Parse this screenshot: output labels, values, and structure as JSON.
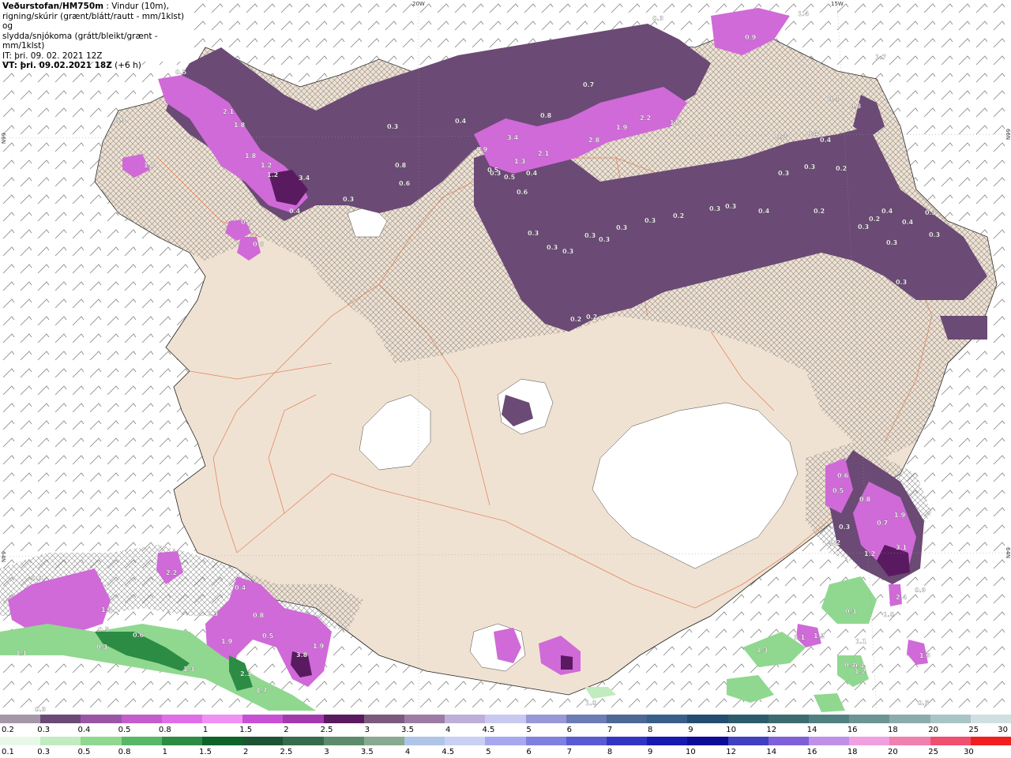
{
  "header": {
    "title": "Veðurstofan/HM750m",
    "desc_1": " : Vindur (10m),",
    "desc_2": "rigning/skúrir (grænt/blátt/rautt - mm/1klst) og",
    "desc_3": "slydda/snjókoma (grátt/bleikt/grænt - mm/1klst)",
    "it_line": "IT: þri. 09. 02. 2021 12Z",
    "vt_label": "VT: þri. 09.02.2021 18Z",
    "vt_offset": " (+6 h)"
  },
  "coords": {
    "lon_top_1": "20W",
    "lon_top_2": "15W",
    "lat_left_1": "66N",
    "lat_right_1": "66N",
    "lat_left_2": "64N",
    "lat_right_2": "64N"
  },
  "colors": {
    "land": "#f0e2d2",
    "sea": "#ffffff",
    "hatch": "#8a8a8a",
    "snow_1": "#6b4a75",
    "snow_2": "#9a55a6",
    "snow_3": "#d06ad8",
    "snow_4": "#e888f0",
    "snow_5": "#f0a8f4",
    "rain_1": "#c8f0c8",
    "rain_2": "#3cb45a",
    "rain_3": "#0e6e2e",
    "roads": "#e07850",
    "glacier": "#ffffff"
  },
  "values_on_map": [
    "0.5",
    "2.1",
    "1.8",
    "1.8",
    "1.2",
    "1.2",
    "3.4",
    "0.4",
    "1.7",
    "0.7",
    "0.6",
    "0.3",
    "0.3",
    "0.3",
    "0.4",
    "0.8",
    "1.4",
    "0.3",
    "0.9",
    "1.7",
    "0.7",
    "0.8",
    "0.6",
    "0.3",
    "0.4",
    "3.4",
    "0.9",
    "0.5",
    "1.3",
    "2.1",
    "2.8",
    "1.9",
    "2.2",
    "1.6",
    "0.2",
    "0.3",
    "0.4",
    "0.8",
    "0.4",
    "0.4",
    "0.5",
    "0.6",
    "0.3",
    "0.3",
    "0.3",
    "0.3",
    "0.3",
    "0.2",
    "0.2",
    "0.3",
    "0.3",
    "0.2",
    "0.3",
    "0.3",
    "0.4",
    "0.3",
    "0.2",
    "0.4",
    "0.3",
    "0.4",
    "0.3",
    "0.3",
    "0.3",
    "0.2",
    "0.2",
    "0.3",
    "1.2",
    "0.3",
    "0.6",
    "0.5",
    "0.8",
    "1.9",
    "0.7",
    "3.1",
    "1.2",
    "0.9",
    "2.4",
    "1.0",
    "0.3",
    "0.4",
    "0.9",
    "1.3",
    "0.5",
    "0.6",
    "0.3",
    "1.1",
    "1.3",
    "1.9",
    "2.3",
    "1.7",
    "3.8",
    "1.9",
    "0.4",
    "0.8",
    "0.5",
    "1.3",
    "2.2",
    "1.2",
    "1.0",
    "0.9",
    "1.3",
    "1.3",
    "1.1",
    "3.1",
    "0.4",
    "1.2",
    "0.5"
  ],
  "legend": {
    "row1_labels": [
      "0.2",
      "0.3",
      "0.4",
      "0.5",
      "0.8",
      "1",
      "1.5",
      "2",
      "2.5",
      "3",
      "3.5",
      "4",
      "4.5",
      "5",
      "6",
      "7",
      "8",
      "9",
      "10",
      "12",
      "14",
      "16",
      "18",
      "20",
      "25",
      "30"
    ],
    "row1_colors": [
      "#a596a8",
      "#6b4a75",
      "#9a55a6",
      "#c35ccc",
      "#e06ee8",
      "#f090f5",
      "#c850d4",
      "#a23aae",
      "#5a1a60",
      "#7c5a7e",
      "#9c7ca4",
      "#bcb0d8",
      "#c8c8f0",
      "#9898d8",
      "#6c7cb4",
      "#4c6894",
      "#3a5e8a",
      "#244c70",
      "#2a5c6c",
      "#3c6c70",
      "#508080",
      "#6c9494",
      "#8cacac",
      "#a8c4c4",
      "#d0e0e0"
    ],
    "row2_labels": [
      "0.1",
      "0.3",
      "0.5",
      "0.8",
      "1",
      "1.5",
      "2",
      "2.5",
      "3",
      "3.5",
      "4",
      "4.5",
      "5",
      "6",
      "7",
      "8",
      "9",
      "10",
      "12",
      "14",
      "16",
      "18",
      "20",
      "25",
      "30"
    ],
    "row2_colors": [
      "#e8f8e8",
      "#c0ecc0",
      "#90d890",
      "#58b868",
      "#2c8c44",
      "#0e6428",
      "#1e5434",
      "#366c4c",
      "#5c8c6c",
      "#88aa90",
      "#b0c4e8",
      "#c8d0f4",
      "#a8a8f0",
      "#8080e0",
      "#5a5ad4",
      "#3434c4",
      "#1a1ab0",
      "#0c0c98",
      "#4040c0",
      "#8060d8",
      "#c090e8",
      "#f0a0e0",
      "#f080b0",
      "#f05070",
      "#f02020"
    ]
  }
}
